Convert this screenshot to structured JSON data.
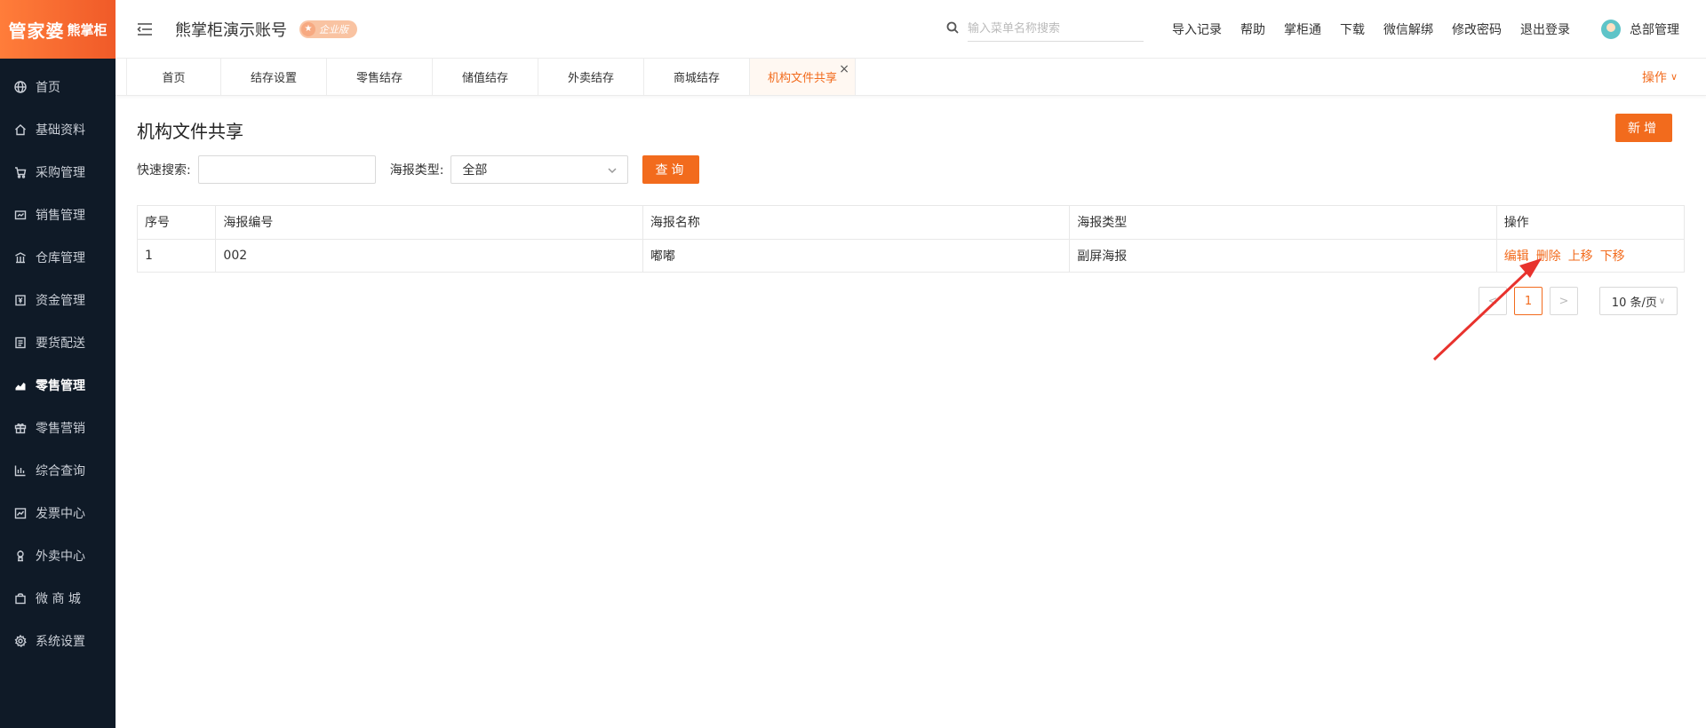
{
  "logo": {
    "brand_main": "管家婆",
    "brand_sub": "熊掌柜"
  },
  "sidebar": {
    "items": [
      {
        "label": "首页",
        "icon": "globe-icon"
      },
      {
        "label": "基础资料",
        "icon": "home-icon"
      },
      {
        "label": "采购管理",
        "icon": "cart-icon"
      },
      {
        "label": "销售管理",
        "icon": "sales-icon"
      },
      {
        "label": "仓库管理",
        "icon": "warehouse-icon"
      },
      {
        "label": "资金管理",
        "icon": "money-icon"
      },
      {
        "label": "要货配送",
        "icon": "delivery-icon"
      },
      {
        "label": "零售管理",
        "icon": "chart-icon",
        "active": true
      },
      {
        "label": "零售营销",
        "icon": "gift-icon"
      },
      {
        "label": "综合查询",
        "icon": "bar-chart-icon"
      },
      {
        "label": "发票中心",
        "icon": "invoice-icon"
      },
      {
        "label": "外卖中心",
        "icon": "takeout-icon"
      },
      {
        "label": "微 商 城",
        "icon": "shop-icon"
      },
      {
        "label": "系统设置",
        "icon": "gear-icon"
      }
    ]
  },
  "header": {
    "account": "熊掌柜演示账号",
    "edition_badge": "企业版",
    "search_placeholder": "输入菜单名称搜索",
    "links": [
      "导入记录",
      "帮助",
      "掌柜通",
      "下载",
      "微信解绑",
      "修改密码",
      "退出登录"
    ],
    "user_name": "总部管理"
  },
  "tabs": {
    "items": [
      "首页",
      "结存设置",
      "零售结存",
      "储值结存",
      "外卖结存",
      "商城结存",
      "机构文件共享"
    ],
    "active_index": 6,
    "close_symbol": "×",
    "ops_label": "操作"
  },
  "page": {
    "title": "机构文件共享",
    "add_button": "新增",
    "quick_search_label": "快速搜索:",
    "type_label": "海报类型:",
    "type_value": "全部",
    "query_button": "查询"
  },
  "table": {
    "columns": [
      "序号",
      "海报编号",
      "海报名称",
      "海报类型",
      "操作"
    ],
    "rows": [
      {
        "index": "1",
        "code": "002",
        "name": "嘟嘟",
        "type": "副屏海报"
      }
    ],
    "row_actions": [
      "编辑",
      "删除",
      "上移",
      "下移"
    ]
  },
  "pagination": {
    "prev": "<",
    "current": "1",
    "next": ">",
    "page_size": "10 条/页"
  },
  "colors": {
    "accent": "#f26b1d",
    "sidebar_bg": "#0f1a27",
    "annotation_arrow": "#e8322d"
  }
}
